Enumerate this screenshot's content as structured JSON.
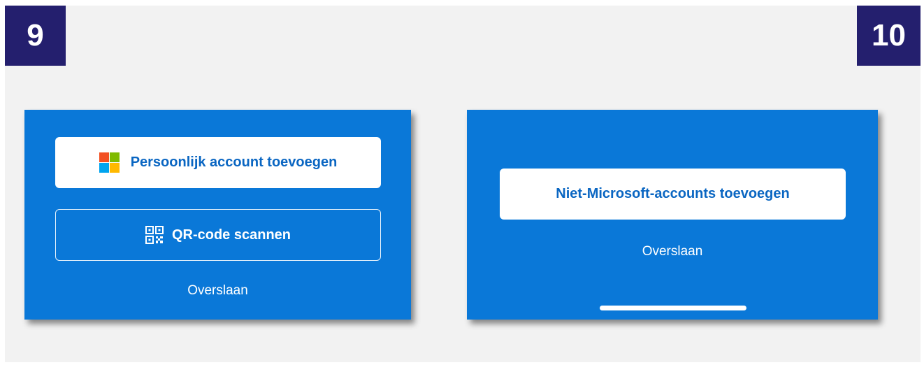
{
  "steps": {
    "left_number": "9",
    "right_number": "10"
  },
  "screen_left": {
    "personal_account_button": "Persoonlijk account toevoegen",
    "qr_button": "QR-code scannen",
    "skip": "Overslaan"
  },
  "screen_right": {
    "non_microsoft_button": "Niet-Microsoft-accounts toevoegen",
    "skip": "Overslaan"
  },
  "icons": {
    "ms_logo": "microsoft-logo-icon",
    "qr": "qr-code-icon"
  },
  "colors": {
    "panel_blue": "#0a78d8",
    "badge_navy": "#241f6e",
    "button_text_blue": "#0a66c2",
    "ms_red": "#f25022",
    "ms_green": "#7fba00",
    "ms_blue": "#00a4ef",
    "ms_yellow": "#ffb900"
  }
}
